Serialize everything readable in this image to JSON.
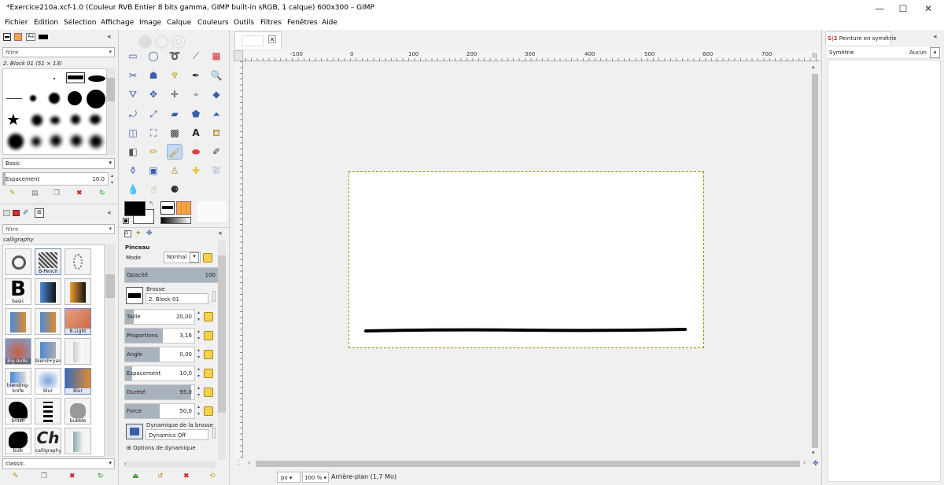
{
  "window": {
    "title": "*Exercice210a.xcf-1.0 (Couleur RVB Entier 8 bits gamma, GIMP built-in sRGB, 1 calque) 600x300 – GIMP",
    "minimize": "—",
    "maximize": "☐",
    "close": "✕"
  },
  "menu": [
    "Fichier",
    "Edition",
    "Sélection",
    "Affichage",
    "Image",
    "Calque",
    "Couleurs",
    "Outils",
    "Filtres",
    "Fenêtres",
    "Aide"
  ],
  "brushes_panel": {
    "filter_placeholder": "filtre",
    "selected_brush": "2. Block 01 (51 × 13)",
    "preset": "Basic",
    "spacing_label": "Espacement",
    "spacing_value": "10.0"
  },
  "presets_panel": {
    "filter_placeholder": "filtre",
    "tag": "calligraphy",
    "preset_bottom": "classic.",
    "items": [
      "",
      "B-Pencil",
      "",
      "basic",
      "",
      "",
      "",
      "",
      "B.Light",
      "Big AirBr.",
      "blend+paint",
      "",
      "blending-knife",
      "blur",
      "Blur",
      "brush",
      "",
      "bubble",
      "bulk",
      "calligraphy",
      ""
    ]
  },
  "tool_options": {
    "title": "Pinceau",
    "mode_label": "Mode",
    "mode_value": "Normal",
    "opacity_label": "Opacité",
    "opacity_value": "100",
    "opacity_fraction": 1.0,
    "brush_label": "Brosse",
    "brush_value": "2. Block 01",
    "size_label": "Taille",
    "size_value": "20,00",
    "size_fraction": 0.12,
    "aspect_label": "Proportions",
    "aspect_value": "3,16",
    "aspect_fraction": 0.55,
    "angle_label": "Angle",
    "angle_value": "0,00",
    "angle_fraction": 0.5,
    "spacing_label": "Espacement",
    "spacing_value": "10,0",
    "spacing_fraction": 0.1,
    "hardness_label": "Dureté",
    "hardness_value": "95,0",
    "hardness_fraction": 0.95,
    "force_label": "Force",
    "force_value": "50,0",
    "force_fraction": 0.5,
    "dynamics_label": "Dynamique de la brosse",
    "dynamics_value": "Dynamics Off",
    "dynamics_options": "Options de dynamique"
  },
  "ruler": {
    "ticks": [
      "-100",
      "0",
      "100",
      "200",
      "300",
      "400",
      "500",
      "600",
      "700"
    ]
  },
  "status": {
    "unit": "px",
    "zoom": "100 %",
    "layer_info": "Arrière-plan (1,7 Mo)"
  },
  "right_panel": {
    "tab": "Peinture en symétrie",
    "symmetry_label": "Symétrie",
    "symmetry_value": "Aucun"
  },
  "colors": {
    "fg": "#000000",
    "bg": "#ffffff",
    "accent": "#f5a542",
    "selection": "#c7d9ef"
  }
}
